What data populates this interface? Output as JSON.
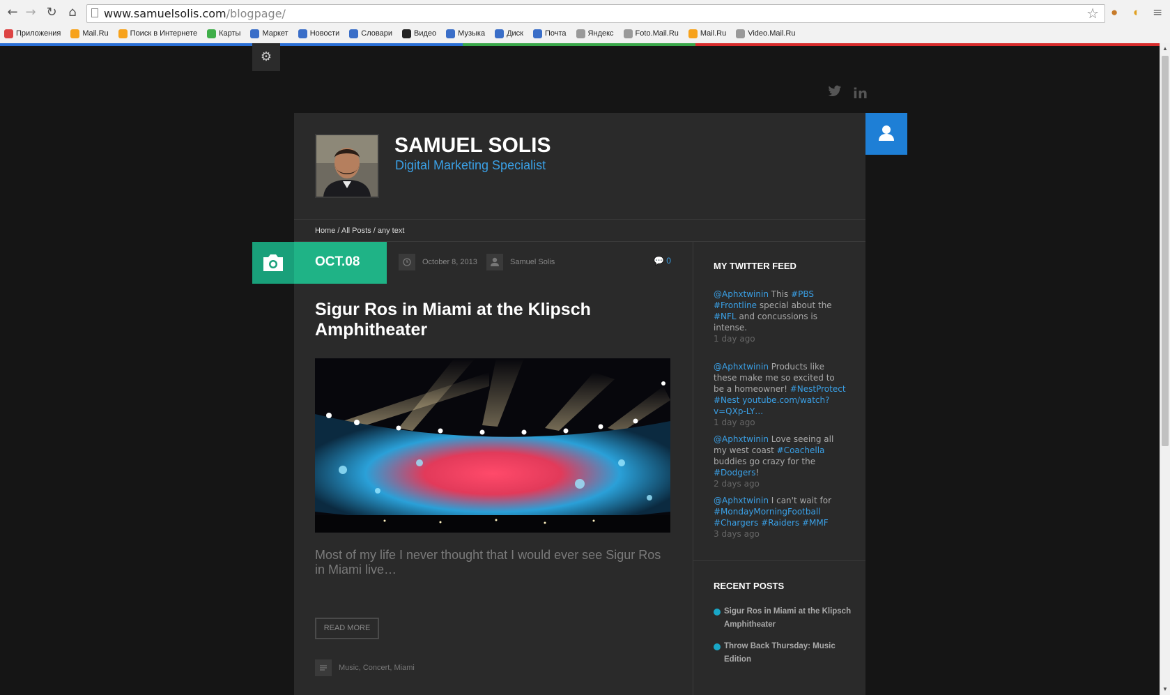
{
  "browser": {
    "url_host": "www.samuelsolis.com",
    "url_path": "/blogpage/",
    "bookmarks": [
      {
        "label": "Приложения",
        "color": "#d44"
      },
      {
        "label": "Mail.Ru",
        "color": "#f7a21b"
      },
      {
        "label": "Поиск в Интернете",
        "color": "#f7a21b"
      },
      {
        "label": "Карты",
        "color": "#3fae49"
      },
      {
        "label": "Маркет",
        "color": "#3a6ec8"
      },
      {
        "label": "Новости",
        "color": "#3a6ec8"
      },
      {
        "label": "Словари",
        "color": "#3a6ec8"
      },
      {
        "label": "Видео",
        "color": "#222"
      },
      {
        "label": "Музыка",
        "color": "#3a6ec8"
      },
      {
        "label": "Диск",
        "color": "#3a6ec8"
      },
      {
        "label": "Почта",
        "color": "#3a6ec8"
      },
      {
        "label": "Яндекс",
        "color": "#999"
      },
      {
        "label": "Foto.Mail.Ru",
        "color": "#999"
      },
      {
        "label": "Mail.Ru",
        "color": "#f7a21b"
      },
      {
        "label": "Video.Mail.Ru",
        "color": "#999"
      }
    ]
  },
  "header": {
    "name": "SAMUEL SOLIS",
    "subtitle": "Digital Marketing Specialist",
    "breadcrumb": "Home / All Posts / any text"
  },
  "post": {
    "date_badge": "OCT.08",
    "date": "October 8, 2013",
    "author": "Samuel Solis",
    "comments": "0",
    "title": "Sigur Ros in Miami at the Klipsch Amphitheater",
    "excerpt": "Most of my life I never thought that I would ever see Sigur Ros in Miami live…",
    "read_more": "READ MORE",
    "tags": "Music, Concert, Miami"
  },
  "sidebar": {
    "twitter_title": "MY TWITTER FEED",
    "tweets": [
      {
        "handle": "@Aphxtwinin",
        "pre": " This ",
        "t1": "#PBS",
        "mid": "",
        "t2": "#Frontline",
        "post": " special about the ",
        "t3": "#NFL",
        "end": " and concussions is intense.",
        "ago": "1 day ago"
      },
      {
        "handle": "@Aphxtwinin",
        "pre": " Products like these make me so excited to be a homeowner! ",
        "t1": "#NestProtect",
        "mid": " ",
        "t2": "#Nest",
        "post": " ",
        "t3": "youtube.com/watch?v=QXp-LY…",
        "end": "",
        "ago": "1 day ago"
      },
      {
        "handle": "@Aphxtwinin",
        "pre": " Love seeing all my west coast ",
        "t1": "#Coachella",
        "mid": " buddies go crazy for the ",
        "t2": "#Dodgers",
        "post": "!",
        "t3": "",
        "end": "",
        "ago": "2 days ago"
      },
      {
        "handle": "@Aphxtwinin",
        "pre": " I can't wait for ",
        "t1": "#MondayMorningFootball",
        "mid": " ",
        "t2": "#Chargers",
        "post": " ",
        "t3": "#Raiders #MMF",
        "end": "",
        "ago": "3 days ago"
      }
    ],
    "recent_title": "RECENT POSTS",
    "recent": [
      "Sigur Ros in Miami at the Klipsch Amphitheater",
      "Throw Back Thursday: Music Edition"
    ]
  },
  "colors": {
    "accent_green": "#1fb386",
    "accent_blue": "#1e7fd6",
    "link": "#3aa0e6"
  }
}
